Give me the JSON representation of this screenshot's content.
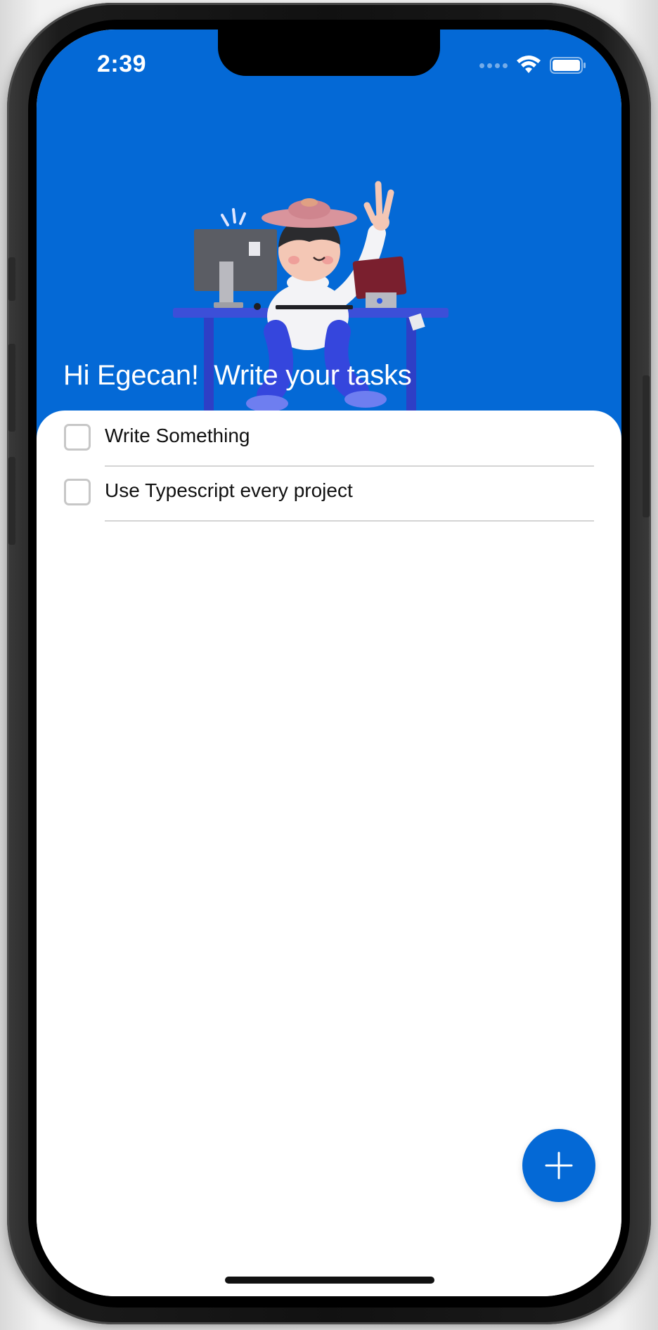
{
  "status_bar": {
    "time": "2:39",
    "signal_icon": "cellular-signal-icon",
    "wifi_icon": "wifi-icon",
    "battery_icon": "battery-icon"
  },
  "header": {
    "greeting": "Hi Egecan!  Write your tasks",
    "background_color": "#0469d6",
    "illustration": "person-at-desk-illustration"
  },
  "tasks": [
    {
      "label": "Write Something",
      "checked": false
    },
    {
      "label": "Use Typescript every project",
      "checked": false
    }
  ],
  "fab": {
    "icon": "plus-icon",
    "color": "#0469d6"
  }
}
